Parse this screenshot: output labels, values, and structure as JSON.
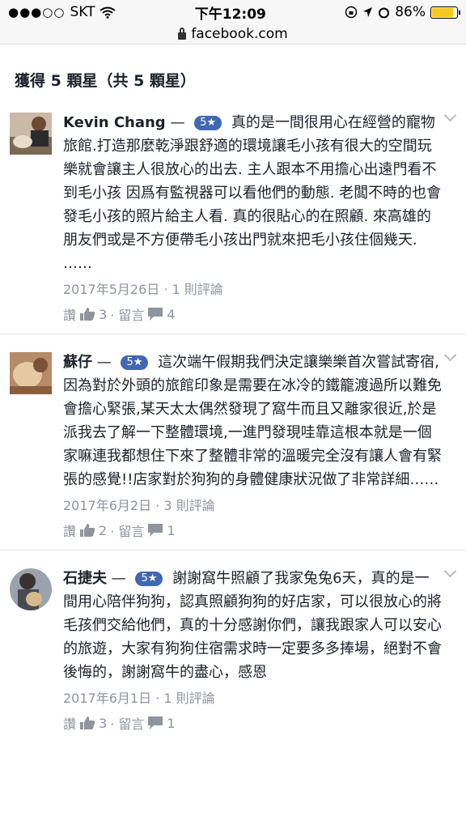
{
  "status": {
    "carrier": "SKT",
    "time": "下午12:09",
    "battery": "86%",
    "battery_level": 0.86
  },
  "browser": {
    "url": "facebook.com"
  },
  "page": {
    "title": "獲得 5 顆星（共 5 顆星）"
  },
  "reviews": [
    {
      "name": "Kevin Chang",
      "dash": "—",
      "rating": "5",
      "text": "真的是一間很用心在經營的寵物旅館.打造那麼乾淨跟舒適的環境讓毛小孩有很大的空間玩樂就會讓主人很放心的出去. 主人跟本不用擔心出遠門看不到毛小孩 因爲有監視器可以看他們的動態. 老闆不時的也會發毛小孩的照片給主人看. 真的很貼心的在照顧. 來高雄的朋友們或是不方便帶毛小孩出門就來把毛小孩住個幾天. ……",
      "meta": "2017年5月26日 · 1 則評論",
      "like_label": "讚",
      "like_count": "3",
      "comment_label": "· 留言",
      "comment_count": "4"
    },
    {
      "name": "蘇仔",
      "dash": "—",
      "rating": "5",
      "text": "這次端午假期我們決定讓樂樂首次嘗試寄宿,因為對於外頭的旅館印象是需要在冰冷的鐵籠渡過所以難免會擔心緊張,某天太太偶然發現了窩牛而且又離家很近,於是派我去了解一下整體環境,一進門發現哇靠這根本就是一個家嘛連我都想住下來了整體非常的溫暖完全沒有讓人會有緊張的感覺!!店家對於狗狗的身體健康狀況做了非常詳細……",
      "meta": "2017年6月2日 · 3 則評論",
      "like_label": "讚",
      "like_count": "2",
      "comment_label": "· 留言",
      "comment_count": "1"
    },
    {
      "name": "石捷夫",
      "dash": "—",
      "rating": "5",
      "text": "謝謝窩牛照顧了我家兔兔6天，真的是一間用心陪伴狗狗，認真照顧狗狗的好店家，可以很放心的將毛孩們交給他們，真的十分感謝你們，讓我跟家人可以安心的旅遊，大家有狗狗住宿需求時一定要多多捧場，絕對不會後悔的，謝謝窩牛的盡心，感恩",
      "meta": "2017年6月1日 · 1 則評論",
      "like_label": "讚",
      "like_count": "3",
      "comment_label": "· 留言",
      "comment_count": "1"
    }
  ],
  "colors": {
    "badge": "#4267b2",
    "meta": "#90949c",
    "battery": "#f6c91d"
  },
  "icons": [
    "signal-dots-icon",
    "wifi-icon",
    "lock-icon",
    "star-icon",
    "thumbs-up-icon",
    "comment-icon",
    "chevron-down-icon"
  ]
}
